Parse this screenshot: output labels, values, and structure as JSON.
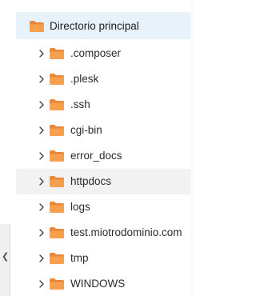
{
  "tree": {
    "root": {
      "label": "Directorio principal",
      "icon": "folder-icon"
    },
    "items": [
      {
        "label": ".composer",
        "icon": "folder-icon"
      },
      {
        "label": ".plesk",
        "icon": "folder-icon"
      },
      {
        "label": ".ssh",
        "icon": "folder-icon"
      },
      {
        "label": "cgi-bin",
        "icon": "folder-icon"
      },
      {
        "label": "error_docs",
        "icon": "folder-icon"
      },
      {
        "label": "httpdocs",
        "icon": "folder-icon"
      },
      {
        "label": "logs",
        "icon": "folder-icon"
      },
      {
        "label": "test.miotrodominio.com",
        "icon": "folder-icon"
      },
      {
        "label": "tmp",
        "icon": "folder-icon"
      },
      {
        "label": "WINDOWS",
        "icon": "folder-icon"
      }
    ]
  },
  "colors": {
    "folder_orange": "#f6a04d",
    "folder_orange_dark": "#e8873a",
    "root_highlight": "#e8f2fb",
    "hover_row": "#f2f2f2"
  }
}
